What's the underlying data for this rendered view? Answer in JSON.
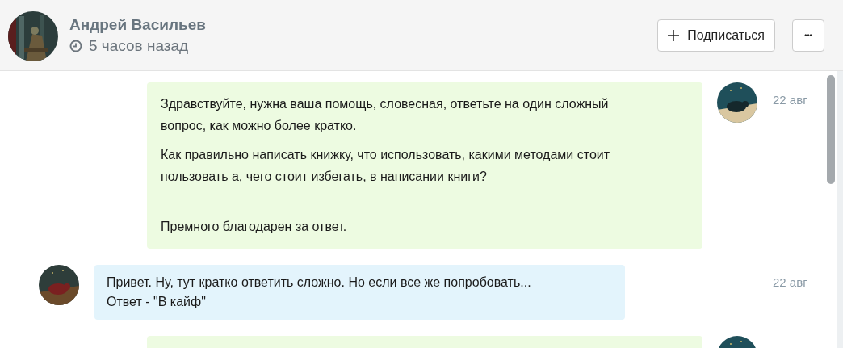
{
  "header": {
    "name": "Андрей Васильев",
    "time": "5 часов назад",
    "subscribe_button": "Подписаться",
    "more_button": "•••"
  },
  "messages": [
    {
      "kind": "out",
      "date": "22 авг",
      "paragraphs": [
        {
          "text": "Здравствуйте, нужна ваша помощь, словесная, ответьте на один сложный вопрос, как можно более кратко.",
          "gap_before": false
        },
        {
          "text": "Как правильно написать книжку,  что использовать, какими методами стоит пользовать а, чего стоит избегать, в написании книги?",
          "gap_before": false
        },
        {
          "text": "Премного благодарен за ответ.",
          "gap_before": true
        }
      ]
    },
    {
      "kind": "in",
      "date": "22 авг",
      "paragraphs": [
        {
          "text": "Привет. Ну, тут кратко ответить сложно. Но если все же попробовать...\nОтвет - \"В кайф\"",
          "gap_before": false
        }
      ]
    },
    {
      "kind": "out"
    }
  ]
}
